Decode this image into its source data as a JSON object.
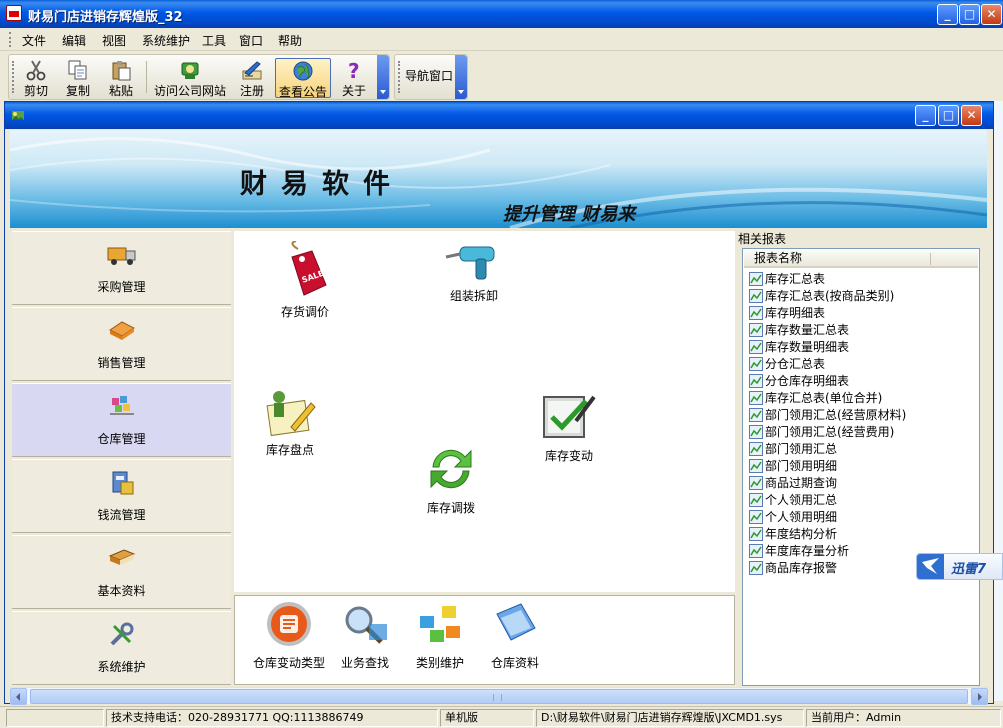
{
  "window": {
    "title": "财易门店进销存辉煌版_32",
    "min_symbol": "_",
    "max_symbol": "□",
    "close_symbol": "✕"
  },
  "menu": [
    "文件",
    "编辑",
    "视图",
    "系统维护",
    "工具",
    "窗口",
    "帮助"
  ],
  "toolbar": {
    "buttons": [
      {
        "label": "剪切",
        "icon": "scissors-icon"
      },
      {
        "label": "复制",
        "icon": "copy-icon"
      },
      {
        "label": "粘贴",
        "icon": "paste-icon"
      },
      {
        "label": "访问公司网站",
        "icon": "web-icon"
      },
      {
        "label": "注册",
        "icon": "register-icon"
      },
      {
        "label": "查看公告",
        "icon": "globe-icon"
      },
      {
        "label": "关于",
        "icon": "question-icon"
      }
    ],
    "nav_window_label": "导航窗口"
  },
  "banner": {
    "title": "财易软件",
    "slogan": "提升管理 财易来"
  },
  "left_nav": [
    {
      "label": "采购管理",
      "icon": "truck-icon"
    },
    {
      "label": "销售管理",
      "icon": "sales-icon"
    },
    {
      "label": "仓库管理",
      "icon": "warehouse-icon"
    },
    {
      "label": "钱流管理",
      "icon": "cashflow-icon"
    },
    {
      "label": "基本资料",
      "icon": "book-icon"
    },
    {
      "label": "系统维护",
      "icon": "tools-icon"
    }
  ],
  "selected_nav_index": 2,
  "center_functions": [
    {
      "label": "存货调价",
      "icon": "price-tag-icon"
    },
    {
      "label": "组装拆卸",
      "icon": "drill-icon"
    },
    {
      "label": "库存盘点",
      "icon": "inventory-check-icon"
    },
    {
      "label": "库存调拨",
      "icon": "transfer-arrows-icon"
    },
    {
      "label": "库存变动",
      "icon": "checkmark-board-icon"
    }
  ],
  "bottom_functions": [
    {
      "label": "仓库变动类型",
      "icon": "change-type-icon"
    },
    {
      "label": "业务查找",
      "icon": "magnifier-icon"
    },
    {
      "label": "类别维护",
      "icon": "category-icon"
    },
    {
      "label": "仓库资料",
      "icon": "warehouse-data-icon"
    }
  ],
  "reports": {
    "heading": "相关报表",
    "column_header": "报表名称",
    "items": [
      "库存汇总表",
      "库存汇总表(按商品类别)",
      "库存明细表",
      "库存数量汇总表",
      "库存数量明细表",
      "分仓汇总表",
      "分仓库存明细表",
      "库存汇总表(单位合并)",
      "部门领用汇总(经营原材料)",
      "部门领用汇总(经营费用)",
      "部门领用汇总",
      "部门领用明细",
      "商品过期查询",
      "个人领用汇总",
      "个人领用明细",
      "年度结构分析",
      "年度库存量分析",
      "商品库存报警"
    ]
  },
  "xunlei_label": "迅雷7",
  "status": {
    "support": "技术支持电话：020-28931771 QQ:1113886749",
    "mode": "单机版",
    "path": "D:\\财易软件\\财易门店进销存辉煌版\\JXCMD1.sys",
    "user": "当前用户：Admin"
  },
  "colors": {
    "xp_blue": "#0058e6",
    "selected_nav": "#d9d8f2",
    "background": "#ece9d8"
  }
}
